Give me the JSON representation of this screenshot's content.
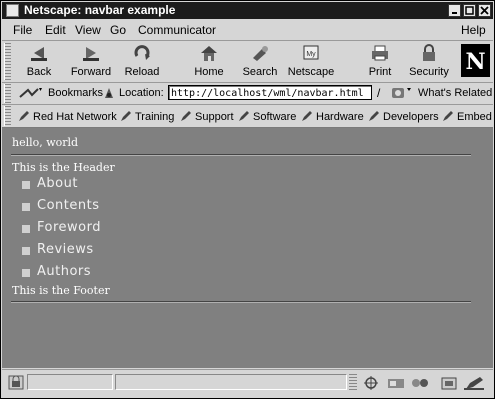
{
  "window": {
    "title": "Netscape: navbar example"
  },
  "menu": [
    "File",
    "Edit",
    "View",
    "Go",
    "Communicator",
    "Help"
  ],
  "toolbar": {
    "back": "Back",
    "forward": "Forward",
    "reload": "Reload",
    "home": "Home",
    "search": "Search",
    "netscape": "Netscape",
    "print": "Print",
    "security": "Security"
  },
  "location": {
    "bookmarks": "Bookmarks",
    "label": "Location:",
    "url": "http://localhost/wml/navbar.html",
    "whats_related": "What's Related"
  },
  "personal_toolbar": [
    "Red Hat Network",
    "Training",
    "Support",
    "Software",
    "Hardware",
    "Developers",
    "Embed"
  ],
  "page": {
    "greeting": "hello, world",
    "header": "This is the Header",
    "nav": [
      "About",
      "Contents",
      "Foreword",
      "Reviews",
      "Authors"
    ],
    "footer": "This is the Footer"
  },
  "colors": {
    "content_bg": "#808080",
    "chrome_bg": "#d6d6d6",
    "titlebar_bg": "#1c1c1c"
  }
}
